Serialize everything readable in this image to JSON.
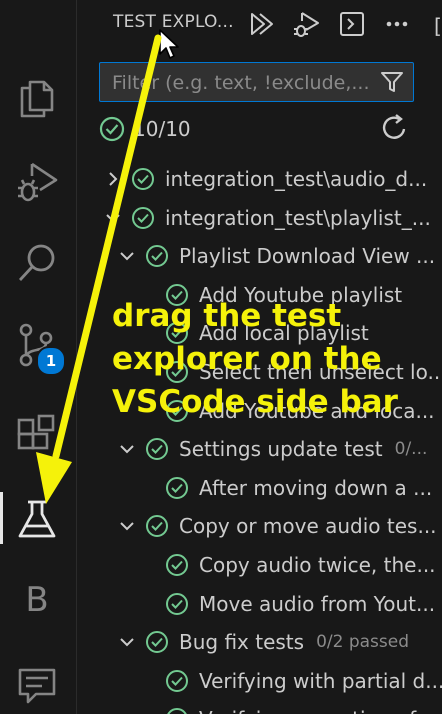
{
  "activity_bar": {
    "items": [
      {
        "icon": "explorer-files-icon"
      },
      {
        "icon": "run-and-debug-icon"
      },
      {
        "icon": "search-icon"
      },
      {
        "icon": "source-control-icon",
        "badge": "1"
      },
      {
        "icon": "extensions-icon"
      },
      {
        "icon": "testing-beaker-icon",
        "active": true
      },
      {
        "icon": "b-extension-icon",
        "letter": "B"
      },
      {
        "icon": "remote-chat-icon"
      }
    ],
    "source_control_badge": "1",
    "b_letter": "B"
  },
  "header": {
    "title": "TEST EXPLO...",
    "actions": [
      "run-tests-icon",
      "debug-tests-icon",
      "terminal-output-icon",
      "more-actions-icon"
    ]
  },
  "filter": {
    "placeholder": "Filter (e.g. text, !exclude,...",
    "value": "",
    "icon": "filter-funnel-icon"
  },
  "summary": {
    "count": "10/10",
    "icon": "passed-check-icon",
    "refresh_icon": "refresh-icon"
  },
  "tree": [
    {
      "label": "integration_test\\audio_d...",
      "depth": 0,
      "expanded": false,
      "sub": ""
    },
    {
      "label": "integration_test\\playlist_...",
      "depth": 0,
      "expanded": true,
      "sub": ""
    },
    {
      "label": "Playlist Download View ...",
      "depth": 1,
      "expanded": true,
      "sub": ""
    },
    {
      "label": "Add Youtube playlist",
      "depth": 2,
      "leaf": true,
      "sub": ""
    },
    {
      "label": "Add local playlist",
      "depth": 2,
      "leaf": true,
      "sub": ""
    },
    {
      "label": "Select then unselect lo...",
      "depth": 2,
      "leaf": true,
      "sub": ""
    },
    {
      "label": "Add Youtube and loca...",
      "depth": 2,
      "leaf": true,
      "sub": ""
    },
    {
      "label": "Settings update test",
      "depth": 1,
      "expanded": true,
      "sub": "0/..."
    },
    {
      "label": "After moving down a ...",
      "depth": 2,
      "leaf": true,
      "sub": ""
    },
    {
      "label": "Copy or move audio tes...",
      "depth": 1,
      "expanded": true,
      "sub": ""
    },
    {
      "label": "Copy audio twice, the...",
      "depth": 2,
      "leaf": true,
      "sub": ""
    },
    {
      "label": "Move audio from Yout...",
      "depth": 2,
      "leaf": true,
      "sub": ""
    },
    {
      "label": "Bug fix tests",
      "depth": 1,
      "expanded": true,
      "sub": "0/2 passed"
    },
    {
      "label": "Verifying with partial d...",
      "depth": 2,
      "leaf": true,
      "sub": ""
    },
    {
      "label": "Verifying execution of...",
      "depth": 2,
      "leaf": true,
      "sub": ""
    }
  ],
  "annotation": {
    "text_lines": [
      "drag the test",
      "explorer on the",
      "VSCode side bar"
    ],
    "color": "#f5f20a"
  },
  "colors": {
    "pass": "#73c991",
    "accent": "#0078d4"
  }
}
